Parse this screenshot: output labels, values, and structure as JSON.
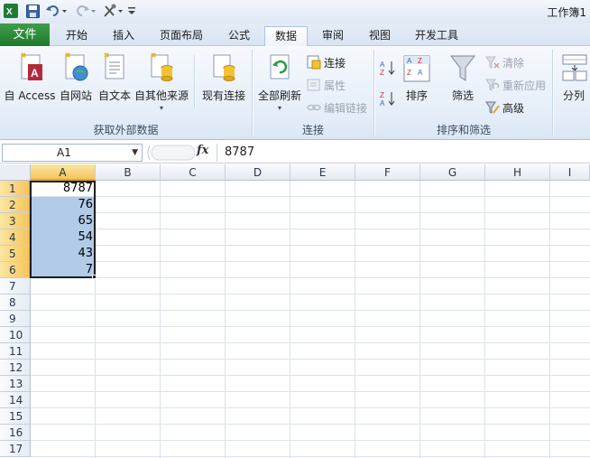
{
  "window": {
    "title": "工作簿1"
  },
  "qat": {
    "icons": [
      "excel-logo-icon",
      "save-icon",
      "undo-icon",
      "redo-icon",
      "tools-icon",
      "customize-qat-icon"
    ]
  },
  "tabs": [
    {
      "label": "文件"
    },
    {
      "label": "开始"
    },
    {
      "label": "插入"
    },
    {
      "label": "页面布局"
    },
    {
      "label": "公式"
    },
    {
      "label": "数据"
    },
    {
      "label": "审阅"
    },
    {
      "label": "视图"
    },
    {
      "label": "开发工具"
    }
  ],
  "ribbon": {
    "get_external": {
      "label": "获取外部数据",
      "from_access": "自 Access",
      "from_web": "自网站",
      "from_text": "自文本",
      "from_other": "自其他来源",
      "existing": "现有连接"
    },
    "connections": {
      "label": "连接",
      "refresh_all": "全部刷新",
      "connections": "连接",
      "properties": "属性",
      "edit_links": "编辑链接"
    },
    "sort_filter": {
      "label": "排序和筛选",
      "sort": "排序",
      "filter": "筛选",
      "clear": "清除",
      "reapply": "重新应用",
      "advanced": "高级"
    },
    "data_tools": {
      "split": "分列"
    }
  },
  "formula_bar": {
    "name_box": "A1",
    "fx": "fx",
    "value": "8787"
  },
  "sheet": {
    "columns": [
      "A",
      "B",
      "C",
      "D",
      "E",
      "F",
      "G",
      "H",
      "I"
    ],
    "rows": [
      "1",
      "2",
      "3",
      "4",
      "5",
      "6",
      "7",
      "8",
      "9",
      "10",
      "11",
      "12",
      "13",
      "14",
      "15",
      "16",
      "17"
    ],
    "column_a_values": [
      "8787",
      "76",
      "65",
      "54",
      "43",
      "7"
    ]
  },
  "colors": {
    "file_tab": "#217a2e",
    "selection_fill": "#b1cbe9",
    "active_header": "#f6c55c"
  }
}
